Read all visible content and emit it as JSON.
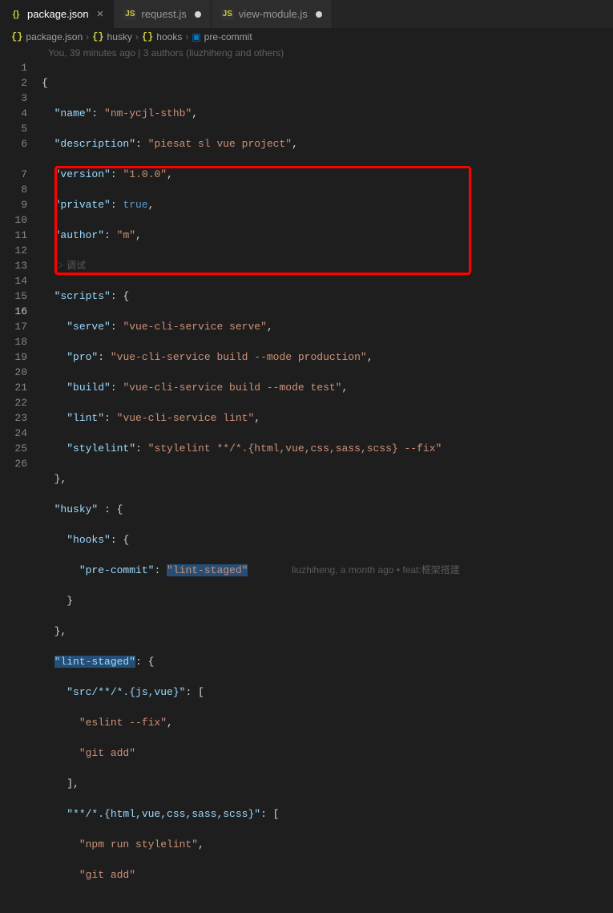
{
  "tabs": [
    {
      "icon": "{}",
      "label": "package.json",
      "state": "close"
    },
    {
      "icon": "JS",
      "label": "request.js",
      "state": "dirty"
    },
    {
      "icon": "JS",
      "label": "view-module.js",
      "state": "dirty"
    }
  ],
  "breadcrumbs": {
    "items": [
      "package.json",
      "husky",
      "hooks",
      "pre-commit"
    ]
  },
  "blame_summary": "You, 39 minutes ago | 3 authors (liuzhiheng and others)",
  "chart_data": {
    "type": "table",
    "title": "package.json",
    "data": {
      "name": "nm-ycjl-sthb",
      "description": "piesat sl vue project",
      "version": "1.0.0",
      "private": true,
      "author": "m",
      "scripts": {
        "serve": "vue-cli-service serve",
        "pro": "vue-cli-service build --mode production",
        "build": "vue-cli-service build --mode test",
        "lint": "vue-cli-service lint",
        "stylelint": "stylelint **/*.{html,vue,css,sass,scss} --fix"
      },
      "husky": {
        "hooks": {
          "pre-commit": "lint-staged"
        }
      },
      "lint-staged": {
        "src/**/*.{js,vue}": [
          "eslint --fix",
          "git add"
        ],
        "**/*.{html,vue,css,sass,scss}": [
          "npm run stylelint",
          "git add"
        ]
      }
    }
  },
  "lines": {
    "l1": "{",
    "l2a": "\"name\"",
    "l2b": "\"nm-ycjl-sthb\"",
    "l3a": "\"description\"",
    "l3b": "\"piesat sl vue project\"",
    "l4a": "\"version\"",
    "l4b": "\"1.0.0\"",
    "l5a": "\"private\"",
    "l5b": "true",
    "l6a": "\"author\"",
    "l6b": "\"m\"",
    "l6debug": "▷ 调试",
    "l7a": "\"scripts\"",
    "l8a": "\"serve\"",
    "l8b": "\"vue-cli-service serve\"",
    "l9a": "\"pro\"",
    "l9b": "\"vue-cli-service build --mode production\"",
    "l10a": "\"build\"",
    "l10b": "\"vue-cli-service build --mode test\"",
    "l11a": "\"lint\"",
    "l11b": "\"vue-cli-service lint\"",
    "l12a": "\"stylelint\"",
    "l12b": "\"stylelint **/*.{html,vue,css,sass,scss} --fix\"",
    "l14a": "\"husky\"",
    "l15a": "\"hooks\"",
    "l16a": "\"pre-commit\"",
    "l16b": "\"lint-staged\"",
    "l16_blame": "liuzhiheng, a month ago • feat:框架搭建",
    "l19a": "\"lint-staged\"",
    "l20a": "\"src/**/*.{js,vue}\"",
    "l21a": "\"eslint --fix\"",
    "l22a": "\"git add\"",
    "l24a": "\"**/*.{html,vue,css,sass,scss}\"",
    "l25a": "\"npm run stylelint\"",
    "l26a": "\"git add\""
  },
  "line_numbers": [
    "1",
    "2",
    "3",
    "4",
    "5",
    "6",
    "",
    "7",
    "8",
    "9",
    "10",
    "11",
    "12",
    "13",
    "14",
    "15",
    "16",
    "17",
    "18",
    "19",
    "20",
    "21",
    "22",
    "23",
    "24",
    "25",
    "26"
  ]
}
